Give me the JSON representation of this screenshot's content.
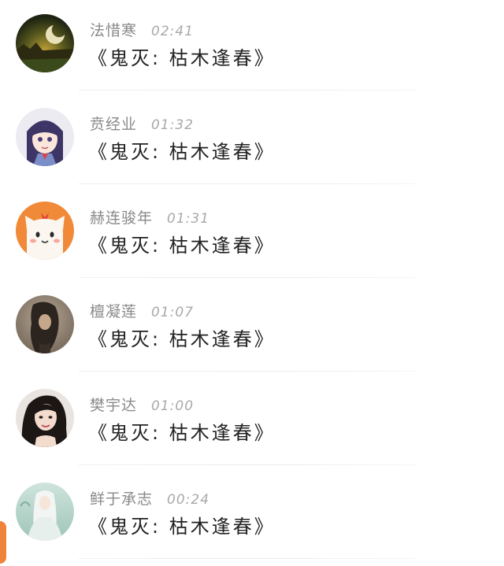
{
  "items": [
    {
      "name": "法惜寒",
      "time": "02:41",
      "message": "《鬼灭: 枯木逢春》",
      "avatar_icon": "landscape-moon-avatar"
    },
    {
      "name": "贲经业",
      "time": "01:32",
      "message": "《鬼灭: 枯木逢春》",
      "avatar_icon": "anime-girl-avatar"
    },
    {
      "name": "赫连骏年",
      "time": "01:31",
      "message": "《鬼灭: 枯木逢春》",
      "avatar_icon": "cartoon-cat-avatar"
    },
    {
      "name": "檀凝莲",
      "time": "01:07",
      "message": "《鬼灭: 枯木逢春》",
      "avatar_icon": "dark-hair-photo-avatar"
    },
    {
      "name": "樊宇达",
      "time": "01:00",
      "message": "《鬼灭: 枯木逢春》",
      "avatar_icon": "woman-portrait-avatar"
    },
    {
      "name": "鲜于承志",
      "time": "00:24",
      "message": "《鬼灭: 枯木逢春》",
      "avatar_icon": "white-haired-figure-avatar"
    }
  ],
  "colors": {
    "name": "#8a8a8a",
    "time": "#a9a9a9",
    "message": "#222222",
    "accent": "#f0833a"
  }
}
